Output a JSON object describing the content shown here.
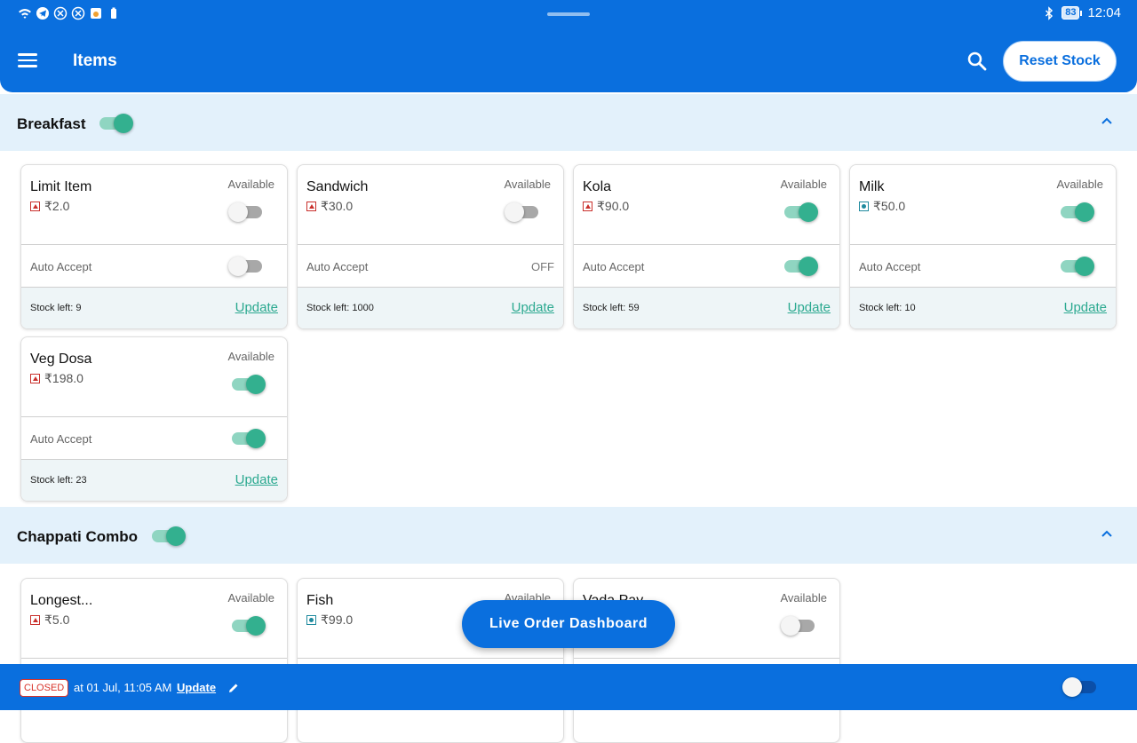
{
  "status_bar": {
    "icons": [
      "wifi-icon",
      "telegram-icon",
      "x-icon",
      "x-icon",
      "app-icon",
      "battery-saver-icon"
    ],
    "bluetooth_icon": "bluetooth-icon",
    "battery_level": "83",
    "time": "12:04"
  },
  "header": {
    "menu_icon": "hamburger-menu-icon",
    "title": "Items",
    "search_icon": "search-icon",
    "reset_stock_label": "Reset Stock"
  },
  "categories": [
    {
      "name": "Breakfast",
      "enabled": true,
      "items": [
        {
          "name": "Limit Item",
          "price": "₹2.0",
          "type": "non-veg",
          "available_label": "Available",
          "available": false,
          "auto_accept_label": "Auto Accept",
          "auto_accept": false,
          "stock_text": "Stock left: 9",
          "update_label": "Update"
        },
        {
          "name": "Sandwich",
          "price": "₹30.0",
          "type": "non-veg",
          "available_label": "Available",
          "available": false,
          "auto_accept_label": "Auto Accept",
          "auto_accept_text": "OFF",
          "stock_text": "Stock left: 1000",
          "update_label": "Update"
        },
        {
          "name": "Kola",
          "price": "₹90.0",
          "type": "non-veg",
          "available_label": "Available",
          "available": true,
          "auto_accept_label": "Auto Accept",
          "auto_accept": true,
          "stock_text": "Stock left: 59",
          "update_label": "Update"
        },
        {
          "name": "Milk",
          "price": "₹50.0",
          "type": "veg",
          "available_label": "Available",
          "available": true,
          "auto_accept_label": "Auto Accept",
          "auto_accept": true,
          "stock_text": "Stock left: 10",
          "update_label": "Update"
        },
        {
          "name": "Veg Dosa",
          "price": "₹198.0",
          "type": "non-veg",
          "available_label": "Available",
          "available": true,
          "auto_accept_label": "Auto Accept",
          "auto_accept": true,
          "stock_text": "Stock left: 23",
          "update_label": "Update"
        }
      ]
    },
    {
      "name": "Chappati Combo",
      "enabled": true,
      "items": [
        {
          "name": "Longest...",
          "price": "₹5.0",
          "type": "non-veg",
          "available_label": "Available",
          "available": true
        },
        {
          "name": "Fish",
          "price": "₹99.0",
          "type": "veg",
          "available_label": "Available",
          "available": true
        },
        {
          "name": "Vada Pav",
          "available_label": "Available",
          "available": false
        }
      ]
    }
  ],
  "fab_label": "Live Order Dashboard",
  "bottom_bar": {
    "status_badge": "CLOSED",
    "status_text": "at 01 Jul, 11:05 AM",
    "update_label": "Update",
    "edit_icon": "pencil-icon",
    "store_open": false
  },
  "colors": {
    "primary": "#0a6fde",
    "accent": "#33b08f",
    "category_bg": "#e3f1fb",
    "non_veg": "#c9302c",
    "veg": "#1f8a9e"
  }
}
